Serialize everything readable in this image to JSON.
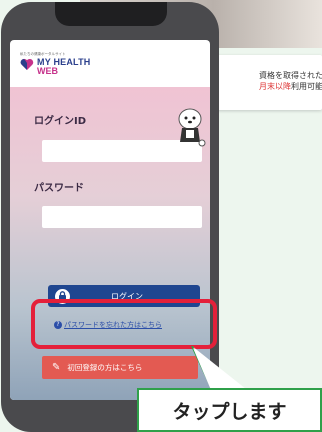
{
  "background_card": {
    "line1": "資格を取得された",
    "line2_red": "月末以降",
    "line2_rest": "利用可能"
  },
  "app": {
    "logo_small": "私たちの健康ポータルサイト",
    "logo_line1": "MY HEALTH",
    "logo_line2": "WEB"
  },
  "login": {
    "id_label": "ログインID",
    "id_value": "",
    "password_label": "パスワード",
    "password_value": "",
    "login_button": "ログイン",
    "forgot_link": "パスワードを忘れた方はこちら",
    "register_button": "初回登録の方はこちら"
  },
  "callout": {
    "text": "タップします"
  },
  "colors": {
    "highlight": "#e4203a",
    "callout_border": "#2fa04a",
    "login_button": "#1f4690",
    "register_button": "#e35a52"
  }
}
